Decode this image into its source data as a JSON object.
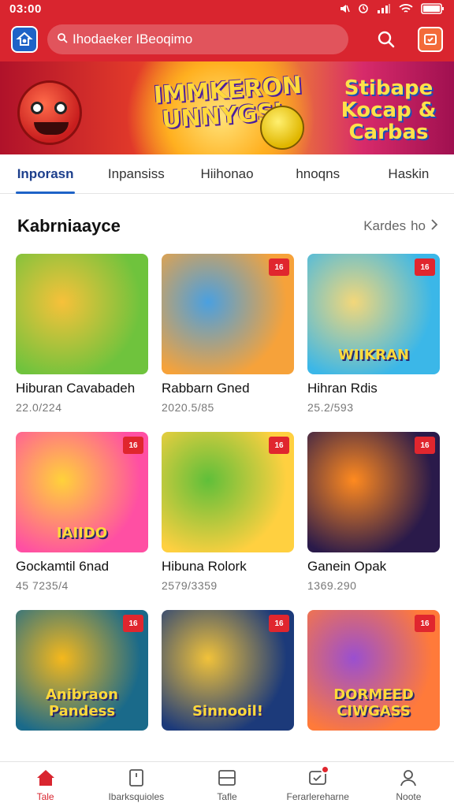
{
  "status_bar": {
    "time": "03:00"
  },
  "search": {
    "lead_icon": "search-glyph",
    "text": "Ihodaeker IBeoqimo"
  },
  "banner": {
    "title": "IMMKERON UNNYGSI",
    "side_title": "Stibape Kocap & Carbas"
  },
  "tabs": [
    {
      "label": "Inporasn",
      "active": true
    },
    {
      "label": "Inpansiss",
      "active": false
    },
    {
      "label": "Hiihonao",
      "active": false
    },
    {
      "label": "hnoqns",
      "active": false
    },
    {
      "label": "Haskin",
      "active": false
    }
  ],
  "section": {
    "title": "Kabrniaayce",
    "more_label": "Kardes",
    "more_suffix": "ho"
  },
  "games": [
    {
      "name": "Hiburan Cavabadeh",
      "stat": "22.0/224",
      "tag": "",
      "caption": "",
      "colors": [
        "#6fc33d",
        "#f7c13a"
      ]
    },
    {
      "name": "Rabbarn Gned",
      "stat": "2020.5/85",
      "tag": "16",
      "caption": "",
      "colors": [
        "#f6a23a",
        "#4aa0e0"
      ]
    },
    {
      "name": "Hihran Rdis",
      "stat": "25.2/593",
      "tag": "16",
      "caption": "WIIKRAN",
      "colors": [
        "#3bb7e8",
        "#f3d77a"
      ]
    },
    {
      "name": "Gockamtil 6nad",
      "stat": "45 7235/4",
      "tag": "16",
      "caption": "IAIIDO",
      "colors": [
        "#ff4fa3",
        "#ffd23a"
      ]
    },
    {
      "name": "Hibuna Rolork",
      "stat": "2579/3359",
      "tag": "16",
      "caption": "",
      "colors": [
        "#ffd040",
        "#5fbf3a"
      ]
    },
    {
      "name": "Ganein Opak",
      "stat": "1369.290",
      "tag": "16",
      "caption": "",
      "colors": [
        "#2a1a4a",
        "#ff8a1f"
      ]
    },
    {
      "name": "",
      "stat": "",
      "tag": "16",
      "caption": "Anibraon Pandess",
      "colors": [
        "#1a6a8a",
        "#f5b81c"
      ]
    },
    {
      "name": "",
      "stat": "",
      "tag": "16",
      "caption": "Sinnooil!",
      "colors": [
        "#1c3a7a",
        "#f1c23a"
      ]
    },
    {
      "name": "",
      "stat": "",
      "tag": "16",
      "caption": "DORMEED CIWGASS",
      "colors": [
        "#ff7a3a",
        "#9a4fd0"
      ]
    }
  ],
  "bottom_nav": [
    {
      "label": "Tale",
      "icon": "home-icon",
      "active": true
    },
    {
      "label": "Ibarksquioles",
      "icon": "bookmark-icon",
      "active": false
    },
    {
      "label": "Tafle",
      "icon": "list-icon",
      "active": false
    },
    {
      "label": "Ferarlereharne",
      "icon": "message-icon",
      "active": false,
      "badge": true
    },
    {
      "label": "Noote",
      "icon": "profile-icon",
      "active": false
    }
  ],
  "colors": {
    "brand_red": "#d9252f",
    "accent_blue": "#1e63c7"
  }
}
